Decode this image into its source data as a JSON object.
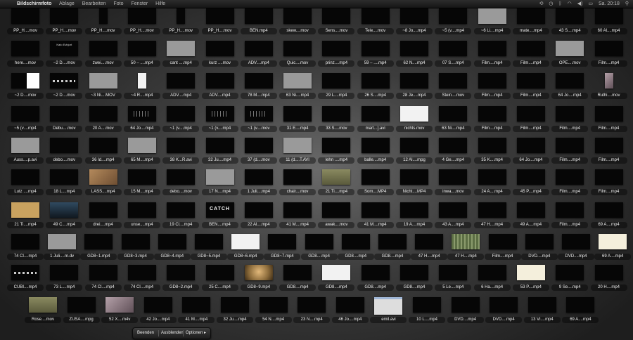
{
  "menubar": {
    "apple_glyph": "",
    "app_name": "Bildschirmfoto",
    "menus": [
      "Ablage",
      "Bearbeiten",
      "Foto",
      "Fenster",
      "Hilfe"
    ],
    "clock": "Sa. 20:18"
  },
  "toolbar": {
    "quit": "Beenden",
    "hide": "Ausblenden",
    "options": "Optionen"
  },
  "rows": [
    [
      {
        "name": "PP_H....mov"
      },
      {
        "name": "PP_H....mov"
      },
      {
        "name": "PP_H....mov",
        "tall": true
      },
      {
        "name": "PP_H....mov"
      },
      {
        "name": "PP_H....mov",
        "tall": true
      },
      {
        "name": "PP_H....mov"
      },
      {
        "name": "BEN.mp4"
      },
      {
        "name": "skew....mov"
      },
      {
        "name": "Sens....mov"
      },
      {
        "name": "Tele....mov"
      },
      {
        "name": "~8 Jo....mp4"
      },
      {
        "name": "~5 (v....mp4"
      },
      {
        "name": "~6 Li....mp4",
        "thumb": "gray"
      },
      {
        "name": "mate....mp4"
      },
      {
        "name": "43 S....mp4"
      },
      {
        "name": "60 Al....mp4"
      }
    ],
    [
      {
        "name": "here....mov"
      },
      {
        "name": "~2 D....mov",
        "thumb": "kato"
      },
      {
        "name": "zwei....mov"
      },
      {
        "name": "50 – ....mp4"
      },
      {
        "name": "cant ....mp4",
        "thumb": "gray"
      },
      {
        "name": "kurz ....mov"
      },
      {
        "name": "ADV....mp4"
      },
      {
        "name": "Quic....mov"
      },
      {
        "name": "prinz....mp4"
      },
      {
        "name": "59 – ....mp4"
      },
      {
        "name": "62 N....mp4"
      },
      {
        "name": "07 S....mp4"
      },
      {
        "name": "Film....mp4"
      },
      {
        "name": "Film....mp4"
      },
      {
        "name": "OPE....mov",
        "thumb": "gray"
      },
      {
        "name": "Film....mp4"
      }
    ],
    [
      {
        "name": "~2 D....mov",
        "thumb": "half"
      },
      {
        "name": "~2 D....mov",
        "thumb": "lines"
      },
      {
        "name": "~3 Ni....MOV",
        "thumb": "gray"
      },
      {
        "name": "~4 R....mp4",
        "thumb": "white",
        "tall": true
      },
      {
        "name": "ADV....mp4"
      },
      {
        "name": "ADV....mp4"
      },
      {
        "name": "78 M....mp4"
      },
      {
        "name": "63 Ni....mp4",
        "thumb": "gray"
      },
      {
        "name": "29 L....mp4"
      },
      {
        "name": "26 S....mp4"
      },
      {
        "name": "28 Je....mp4"
      },
      {
        "name": "Stein....mov"
      },
      {
        "name": "Film....mp4"
      },
      {
        "name": "Film....mp4"
      },
      {
        "name": "64 Jo....mp4"
      },
      {
        "name": "Ruthi....mov",
        "thumb": "mauve",
        "tall": true
      }
    ],
    [
      {
        "name": "~5 (v....mp4"
      },
      {
        "name": "Debu....mov"
      },
      {
        "name": "20 A....mov"
      },
      {
        "name": "64 Jo....mp4",
        "thumb": "dots"
      },
      {
        "name": "~1 (v....mp4"
      },
      {
        "name": "~1 (v....mp4",
        "thumb": "dots"
      },
      {
        "name": "~1 (v....mov",
        "thumb": "dots"
      },
      {
        "name": "31 E....mp4"
      },
      {
        "name": "33 S....mov"
      },
      {
        "name": "mart...].avi"
      },
      {
        "name": "nichts.mov",
        "thumb": "white"
      },
      {
        "name": "63 Ni....mp4"
      },
      {
        "name": "Film....mp4"
      },
      {
        "name": "Film....mp4"
      },
      {
        "name": "Film....mp4"
      },
      {
        "name": "Film....mp4"
      }
    ],
    [
      {
        "name": "Auss....p.avi",
        "thumb": "gray"
      },
      {
        "name": "debo....mov"
      },
      {
        "name": "36 Id....mp4"
      },
      {
        "name": "65 M....mp4",
        "thumb": "gray"
      },
      {
        "name": "38 K...R.avi"
      },
      {
        "name": "32 Ju....mp4"
      },
      {
        "name": "37 (d....mov"
      },
      {
        "name": "11 (d....T.AVI",
        "thumb": "gray"
      },
      {
        "name": "lehn ....mp4"
      },
      {
        "name": "balle....mp4"
      },
      {
        "name": "12 Al....mpg"
      },
      {
        "name": "4 Ge....mp4"
      },
      {
        "name": "35 K....mp4"
      },
      {
        "name": "64 Jo....mp4"
      },
      {
        "name": "Film....mp4"
      },
      {
        "name": "Film....mp4"
      }
    ],
    [
      {
        "name": "Lutz ....mp4"
      },
      {
        "name": "18 L....mp4"
      },
      {
        "name": "LASS....mp4",
        "thumb": "brown"
      },
      {
        "name": "15 M....mp4"
      },
      {
        "name": "debo....mov"
      },
      {
        "name": "17 N....mp4",
        "thumb": "gray"
      },
      {
        "name": "1 Juli....mp4"
      },
      {
        "name": "chair....mov"
      },
      {
        "name": "21 Ti....mp4",
        "thumb": "olive"
      },
      {
        "name": "Som....MP4"
      },
      {
        "name": "Nicht....MP4"
      },
      {
        "name": "inwa....mov"
      },
      {
        "name": "24 A....mp4"
      },
      {
        "name": "45 P....mp4"
      },
      {
        "name": "Film....mp4"
      },
      {
        "name": "Film....mp4"
      }
    ],
    [
      {
        "name": "21 Ti....mp4",
        "thumb": "tan"
      },
      {
        "name": "49 C....mp4",
        "thumb": "blue"
      },
      {
        "name": "drei....mp4"
      },
      {
        "name": "unse....mp4"
      },
      {
        "name": "19 Cl....mp4"
      },
      {
        "name": "BEN....mp4",
        "thumb": "catch"
      },
      {
        "name": "22 Al....mp4"
      },
      {
        "name": "41 M....mp4"
      },
      {
        "name": "awak....mov"
      },
      {
        "name": "41 M....mp4"
      },
      {
        "name": "19 A....mp4"
      },
      {
        "name": "43 A....mp4"
      },
      {
        "name": "47 H....mp4"
      },
      {
        "name": "49 A....mp4"
      },
      {
        "name": "Film....mp4"
      },
      {
        "name": "69 A....mp4"
      }
    ],
    [
      {
        "name": "74 Cl....mp4"
      },
      {
        "name": "1 Juli....rn.dv",
        "thumb": "gray"
      },
      {
        "name": "GD8~1.mp4"
      },
      {
        "name": "GD8~3.mp4"
      },
      {
        "name": "GD8~4.mp4"
      },
      {
        "name": "GD8~5.mp4"
      },
      {
        "name": "GD8~6.mp4",
        "thumb": "white"
      },
      {
        "name": "GD8~7.mp4"
      },
      {
        "name": "GD8....mp4"
      },
      {
        "name": "GD8....mp4"
      },
      {
        "name": "GD8....mp4"
      },
      {
        "name": "47 H....mp4"
      },
      {
        "name": "47 H....mp4",
        "thumb": "forest"
      },
      {
        "name": "Film....mp4"
      },
      {
        "name": "DVD....mp4"
      },
      {
        "name": "DVD....mp4"
      },
      {
        "name": "69 A....mp4",
        "thumb": "cream"
      }
    ],
    [
      {
        "name": "CUBI....mp4",
        "thumb": "lines"
      },
      {
        "name": "73 L....mp4"
      },
      {
        "name": "74 Cl....mp4"
      },
      {
        "name": "74 Cl....mp4"
      },
      {
        "name": "GD8~2.mp4"
      },
      {
        "name": "25 C....mp4"
      },
      {
        "name": "GD8~9.mp4",
        "thumb": "face"
      },
      {
        "name": "GD8....mp4"
      },
      {
        "name": "GD8....mp4",
        "thumb": "white"
      },
      {
        "name": "GD8....mp4"
      },
      {
        "name": "GD8....mp4"
      },
      {
        "name": "5 Le....mp4"
      },
      {
        "name": "6 Ha....mp4"
      },
      {
        "name": "53 P....mp4",
        "thumb": "cream"
      },
      {
        "name": "9 Se....mp4"
      },
      {
        "name": "20 H....mp4"
      }
    ],
    [
      {
        "name": "Rose....mov",
        "thumb": "olive"
      },
      {
        "name": "ZUSA....mpg"
      },
      {
        "name": "52 X....m4v",
        "thumb": "mauve"
      },
      {
        "name": "42 Jo....mp4"
      },
      {
        "name": "41 M....mp4"
      },
      {
        "name": "32 Ju....mp4"
      },
      {
        "name": "54 N....mp4"
      },
      {
        "name": "23 N....mp4"
      },
      {
        "name": "46 Jo....mp4"
      },
      {
        "name": "emil.avi",
        "thumb": "win"
      },
      {
        "name": "10 L....mp4"
      },
      {
        "name": "DVD....mp4"
      },
      {
        "name": "DVD....mp4"
      },
      {
        "name": "13 Vi....mp4"
      },
      {
        "name": "69 A....mp4"
      }
    ]
  ]
}
